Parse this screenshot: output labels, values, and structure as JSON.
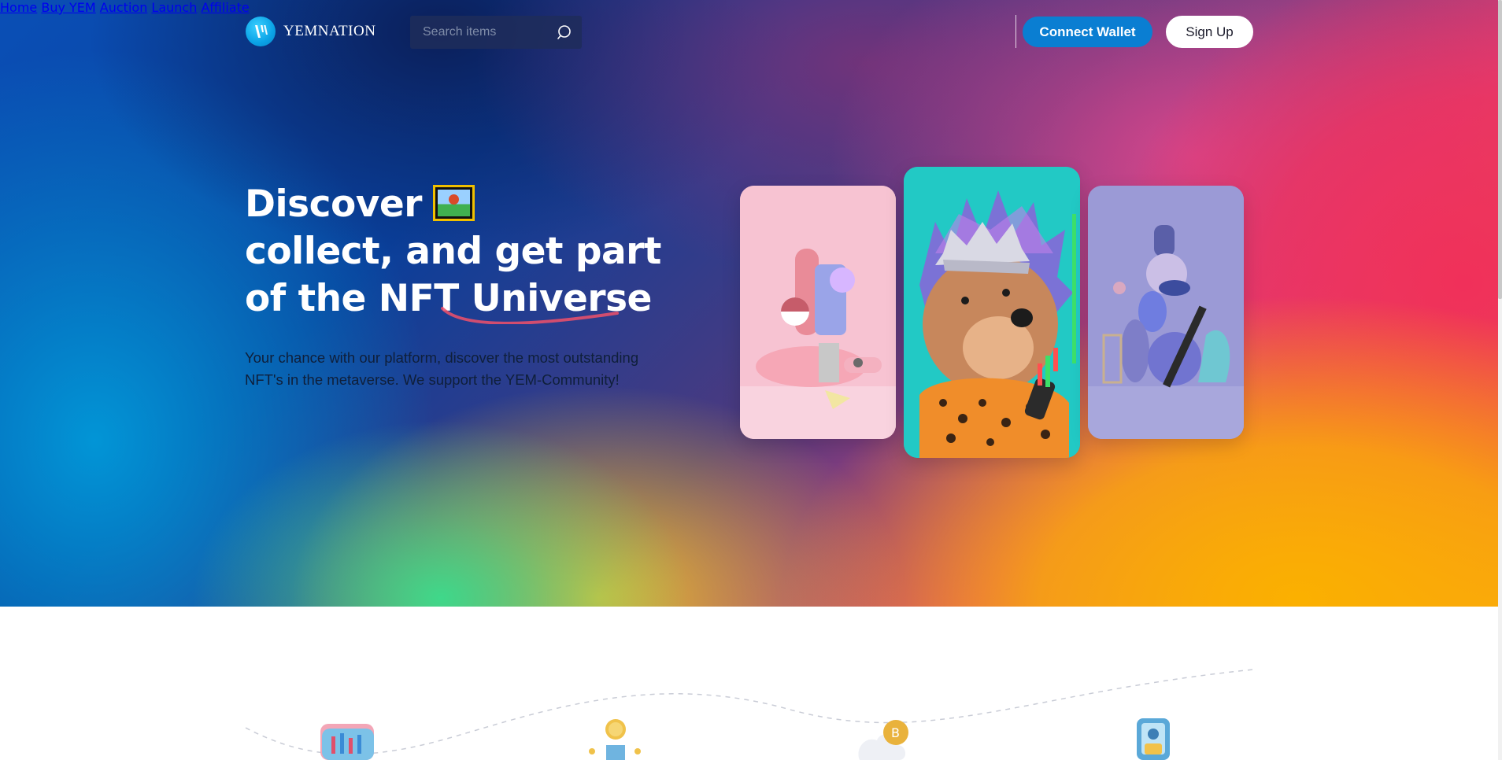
{
  "brand": {
    "name": "YEMNATION"
  },
  "search": {
    "placeholder": "Search items",
    "icon": "search-icon"
  },
  "nav": {
    "items": [
      {
        "label": "Home"
      },
      {
        "label": "Buy YEM"
      },
      {
        "label": "Auction"
      },
      {
        "label": "Launch"
      },
      {
        "label": "Affiliate"
      }
    ]
  },
  "header": {
    "connect_label": "Connect Wallet",
    "signup_label": "Sign Up"
  },
  "hero": {
    "headline_line1": "Discover",
    "headline_line2": "collect, and get part",
    "headline_line3_prefix": "of the NFT ",
    "headline_line3_emphasis": "Universe",
    "subtext": "Your chance with our platform, discover the most outstanding NFT's in the metaverse. We support the YEM-Community!"
  },
  "colors": {
    "accent": "#0a7ed2",
    "swash": "#f0506a",
    "card_left": "#f7c3d2",
    "card_center": "#22c9c5",
    "card_right": "#9b9ad6"
  },
  "features": {
    "icons": [
      "chart-wallet-icon",
      "coin-stack-icon",
      "bitcoin-cloud-icon",
      "mobile-wallet-icon"
    ]
  }
}
